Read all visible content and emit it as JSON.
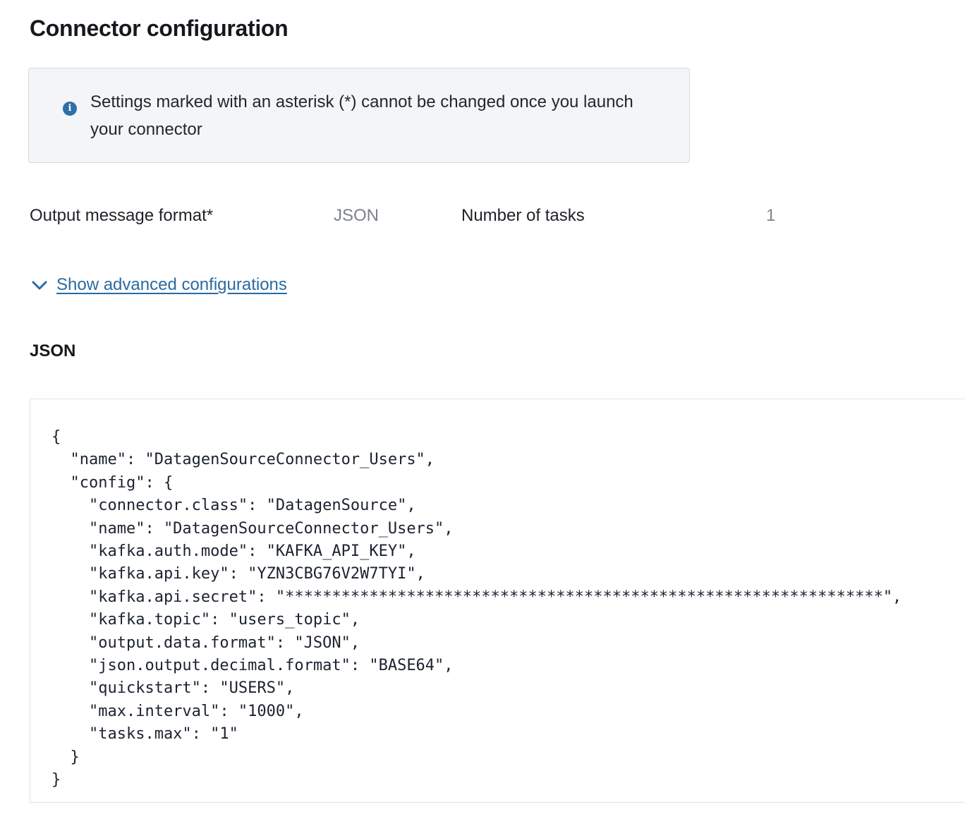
{
  "header": {
    "title": "Connector configuration"
  },
  "info_banner": {
    "icon": "info-circle-icon",
    "icon_color": "#2f6fa7",
    "text": "Settings marked with an asterisk (*) cannot be changed once you launch your connector"
  },
  "fields": {
    "output_format_label": "Output message format*",
    "output_format_value": "JSON",
    "tasks_label": "Number of tasks",
    "tasks_value": "1"
  },
  "advanced": {
    "icon": "chevron-down-icon",
    "label": "Show advanced configurations",
    "link_color": "#2a6aa0"
  },
  "json_section": {
    "title": "JSON",
    "code": "{\n  \"name\": \"DatagenSourceConnector_Users\",\n  \"config\": {\n    \"connector.class\": \"DatagenSource\",\n    \"name\": \"DatagenSourceConnector_Users\",\n    \"kafka.auth.mode\": \"KAFKA_API_KEY\",\n    \"kafka.api.key\": \"YZN3CBG76V2W7TYI\",\n    \"kafka.api.secret\": \"****************************************************************\",\n    \"kafka.topic\": \"users_topic\",\n    \"output.data.format\": \"JSON\",\n    \"json.output.decimal.format\": \"BASE64\",\n    \"quickstart\": \"USERS\",\n    \"max.interval\": \"1000\",\n    \"tasks.max\": \"1\"\n  }\n}"
  }
}
